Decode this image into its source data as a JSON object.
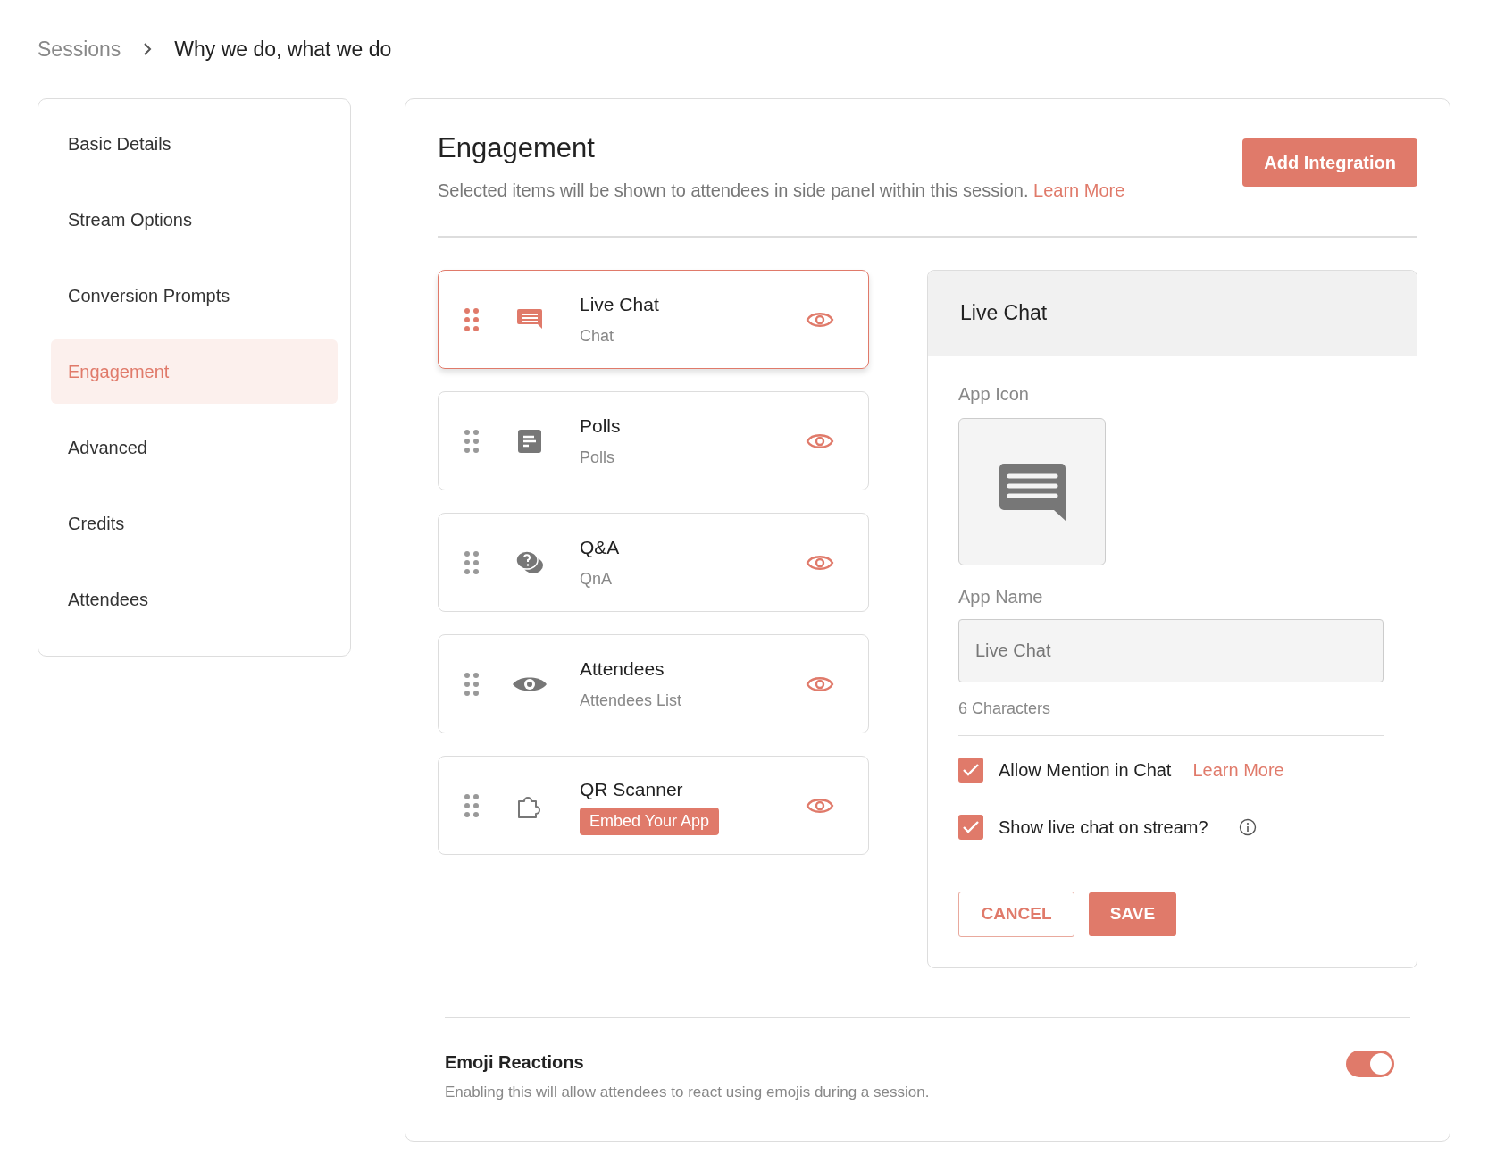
{
  "breadcrumb": [
    {
      "label": "Sessions"
    },
    {
      "label": "Why we do, what we do"
    }
  ],
  "sidebar": {
    "items": [
      {
        "label": "Basic Details",
        "selected": false
      },
      {
        "label": "Stream Options",
        "selected": false
      },
      {
        "label": "Conversion Prompts",
        "selected": false
      },
      {
        "label": "Engagement",
        "selected": true
      },
      {
        "label": "Advanced",
        "selected": false
      },
      {
        "label": "Credits",
        "selected": false
      },
      {
        "label": "Attendees",
        "selected": false
      }
    ]
  },
  "engagement": {
    "title": "Engagement",
    "description": "Selected items will be shown to attendees in side panel within this session.",
    "learn_more": "Learn More",
    "add_button": "Add Integration",
    "apps": [
      {
        "name": "Live Chat",
        "kind": "subtitle",
        "subtitle": "Chat",
        "selected": true
      },
      {
        "name": "Polls",
        "kind": "subtitle",
        "subtitle": "Polls",
        "selected": false
      },
      {
        "name": "Q&A",
        "kind": "subtitle",
        "subtitle": "QnA",
        "selected": false
      },
      {
        "name": "Attendees",
        "kind": "subtitle",
        "subtitle": "Attendees List",
        "selected": false
      },
      {
        "name": "QR Scanner",
        "kind": "badge",
        "badge": "Embed Your App",
        "selected": false
      }
    ],
    "detail": {
      "title": "Live Chat",
      "app_icon_label": "App Icon",
      "app_name_label": "App Name",
      "app_name_value": "Live Chat",
      "char_count": "6 Characters",
      "options": [
        {
          "label": "Allow Mention in Chat",
          "checked": true,
          "link": "Learn More"
        },
        {
          "label": "Show live chat on stream?",
          "checked": true,
          "info": true
        }
      ],
      "cancel": "CANCEL",
      "save": "SAVE"
    },
    "emoji": {
      "title": "Emoji Reactions",
      "description": "Enabling this will allow attendees to react using emojis during a session.",
      "on": true
    }
  }
}
